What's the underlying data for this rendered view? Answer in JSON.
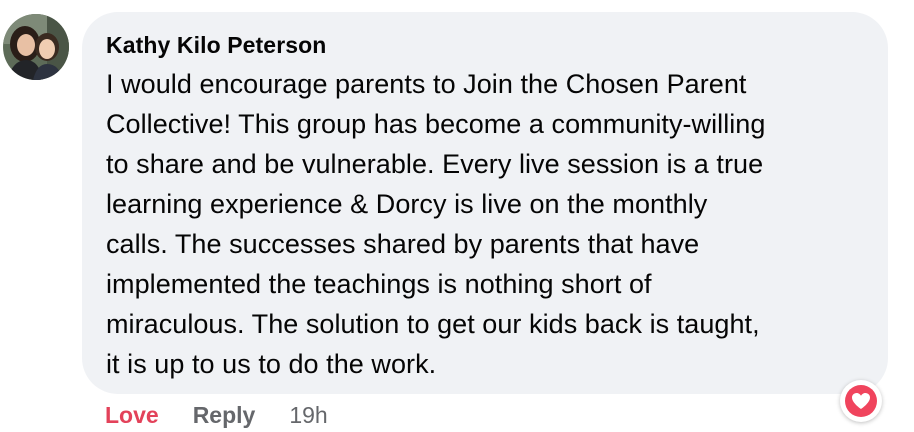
{
  "comment": {
    "author": "Kathy Kilo Peterson",
    "text": "I would encourage parents to Join the Chosen Parent Collective! This group has become a community-willing to share and be vulnerable. Every live session is a true learning experience & Dorcy is live on the monthly calls. The successes shared by parents that have implemented the teachings is nothing short of miraculous. The solution to get our kids back is taught, it is up to us to do the work.",
    "lines": [
      "I would encourage parents to Join the Chosen Parent",
      "Collective! This group has become a community-willing",
      "to share and be vulnerable. Every live session is a true",
      "learning experience & Dorcy is live on the monthly",
      "calls. The successes shared by parents that have",
      "implemented the teachings is nothing short of",
      "miraculous. The solution to get our kids back is taught,",
      "it is up to us to do the work."
    ],
    "reaction_icon": "heart-icon",
    "reaction_color": "#f0445d"
  },
  "actions": {
    "love_label": "Love",
    "reply_label": "Reply",
    "timestamp": "19h"
  },
  "colors": {
    "bubble_bg": "#f0f2f5",
    "love": "#e3425a",
    "secondary_text": "#65676b"
  }
}
